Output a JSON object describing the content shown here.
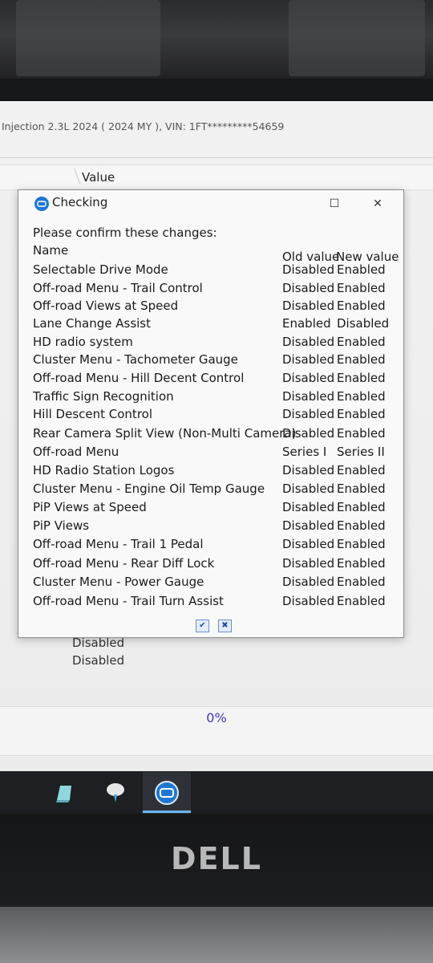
{
  "app": {
    "title_fragment": "Injection 2.3L 2024 ( 2024 MY ), VIN: 1FT*********54659",
    "column_header": "Value",
    "background_values": [
      "Disabled",
      "Disabled"
    ],
    "progress_text": "0%"
  },
  "dialog": {
    "title": "Checking",
    "intro": "Please confirm these changes:",
    "headers": {
      "name": "Name",
      "old": "Old value",
      "new": "New value"
    },
    "rows": [
      {
        "name": "Selectable Drive Mode",
        "old": "Disabled",
        "new": "Enabled"
      },
      {
        "name": "Off-road Menu - Trail Control",
        "old": "Disabled",
        "new": "Enabled"
      },
      {
        "name": "Off-road Views at Speed",
        "old": "Disabled",
        "new": "Enabled"
      },
      {
        "name": "Lane Change Assist",
        "old": "Enabled",
        "new": "Disabled"
      },
      {
        "name": "HD radio system",
        "old": "Disabled",
        "new": "Enabled"
      },
      {
        "name": "Cluster Menu - Tachometer Gauge",
        "old": "Disabled",
        "new": "Enabled"
      },
      {
        "name": "Off-road Menu - Hill Decent Control",
        "old": "Disabled",
        "new": "Enabled"
      },
      {
        "name": "Traffic Sign Recognition",
        "old": "Disabled",
        "new": "Enabled"
      },
      {
        "name": "Hill Descent Control",
        "old": "Disabled",
        "new": "Enabled"
      },
      {
        "name": "Rear Camera Split View (Non-Multi Camera)",
        "old": "Disabled",
        "new": "Enabled"
      },
      {
        "name": "Off-road Menu",
        "old": "Series I",
        "new": "Series II"
      },
      {
        "name": "HD Radio Station Logos",
        "old": "Disabled",
        "new": "Enabled"
      },
      {
        "name": "Cluster Menu - Engine Oil Temp Gauge",
        "old": "Disabled",
        "new": "Enabled"
      },
      {
        "name": "PiP Views at Speed",
        "old": "Disabled",
        "new": "Enabled"
      },
      {
        "name": "PiP Views",
        "old": "Disabled",
        "new": "Enabled"
      },
      {
        "name": "Off-road Menu - Trail 1 Pedal",
        "old": "Disabled",
        "new": "Enabled"
      },
      {
        "name": "Off-road Menu - Rear Diff Lock",
        "old": "Disabled",
        "new": "Enabled"
      },
      {
        "name": "Cluster Menu - Power Gauge",
        "old": "Disabled",
        "new": "Enabled"
      },
      {
        "name": "Off-road Menu - Trail Turn Assist",
        "old": "Disabled",
        "new": "Enabled"
      }
    ],
    "buttons": {
      "confirm_icon": "check-icon",
      "cancel_icon": "x-icon"
    }
  },
  "taskbar": {
    "icons": [
      "notes-app-icon",
      "tool-app-icon",
      "diagnostic-app-icon"
    ]
  },
  "hardware": {
    "logo": "DELL"
  },
  "colors": {
    "accent": "#1e78d2",
    "progress_text": "#3a3ac0"
  }
}
